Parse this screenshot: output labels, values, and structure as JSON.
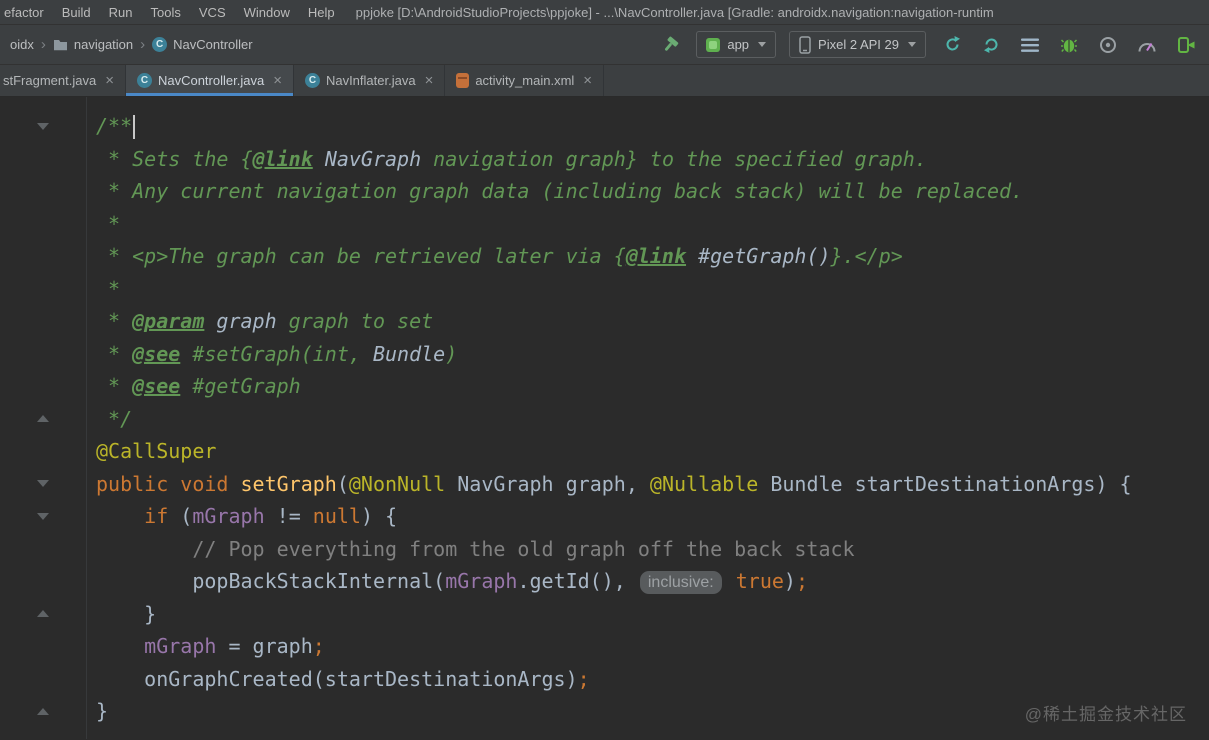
{
  "menu": {
    "items": [
      "efactor",
      "Build",
      "Run",
      "Tools",
      "VCS",
      "Window",
      "Help"
    ],
    "title": "ppjoke [D:\\AndroidStudioProjects\\ppjoke] - ...\\NavController.java [Gradle: androidx.navigation:navigation-runtim"
  },
  "breadcrumb": {
    "items": [
      {
        "label": "oidx",
        "icon": "none"
      },
      {
        "label": "navigation",
        "icon": "folder"
      },
      {
        "label": "NavController",
        "icon": "class"
      }
    ]
  },
  "toolbar": {
    "run_config": "app",
    "device": "Pixel 2 API 29",
    "icon_names": [
      "build-hammer-icon",
      "sync-icon",
      "apply-changes-icon",
      "logcat-list-icon",
      "debug-bug-icon",
      "coverage-icon",
      "profiler-icon",
      "attach-debugger-icon"
    ]
  },
  "tabs": [
    {
      "label": "stFragment.java",
      "icon": "none",
      "selected": false
    },
    {
      "label": "NavController.java",
      "icon": "class",
      "selected": true
    },
    {
      "label": "NavInflater.java",
      "icon": "class",
      "selected": false
    },
    {
      "label": "activity_main.xml",
      "icon": "xml",
      "selected": false
    }
  ],
  "editor": {
    "lines": [
      {
        "fold": "down",
        "tokens": [
          {
            "t": "/**",
            "c": "doc",
            "caret": true
          }
        ]
      },
      {
        "fold": "",
        "tokens": [
          {
            "t": " * Sets the {",
            "c": "doc"
          },
          {
            "t": "@link",
            "c": "docTag"
          },
          {
            "t": " ",
            "c": "doc"
          },
          {
            "t": "NavGraph",
            "c": "docVal"
          },
          {
            "t": " navigation graph} to the specified graph.",
            "c": "doc"
          }
        ]
      },
      {
        "fold": "",
        "tokens": [
          {
            "t": " * Any current navigation graph data (including back stack) will be replaced.",
            "c": "doc"
          }
        ]
      },
      {
        "fold": "",
        "tokens": [
          {
            "t": " *",
            "c": "doc"
          }
        ]
      },
      {
        "fold": "",
        "tokens": [
          {
            "t": " * <p>The graph can be retrieved later via {",
            "c": "doc"
          },
          {
            "t": "@link",
            "c": "docTag"
          },
          {
            "t": " ",
            "c": "doc"
          },
          {
            "t": "#getGraph()",
            "c": "docVal"
          },
          {
            "t": "}.</p>",
            "c": "doc"
          }
        ]
      },
      {
        "fold": "",
        "tokens": [
          {
            "t": " *",
            "c": "doc"
          }
        ]
      },
      {
        "fold": "",
        "tokens": [
          {
            "t": " * ",
            "c": "doc"
          },
          {
            "t": "@param",
            "c": "docTag"
          },
          {
            "t": " ",
            "c": "doc"
          },
          {
            "t": "graph",
            "c": "docVal"
          },
          {
            "t": " graph to set",
            "c": "doc"
          }
        ]
      },
      {
        "fold": "",
        "tokens": [
          {
            "t": " * ",
            "c": "doc"
          },
          {
            "t": "@see",
            "c": "docTag"
          },
          {
            "t": " #setGraph(int, ",
            "c": "doc"
          },
          {
            "t": "Bundle",
            "c": "docVal"
          },
          {
            "t": ")",
            "c": "doc"
          }
        ]
      },
      {
        "fold": "",
        "tokens": [
          {
            "t": " * ",
            "c": "doc"
          },
          {
            "t": "@see",
            "c": "docTag"
          },
          {
            "t": " #getGraph",
            "c": "doc"
          }
        ]
      },
      {
        "fold": "up",
        "tokens": [
          {
            "t": " */",
            "c": "doc"
          }
        ]
      },
      {
        "fold": "",
        "tokens": [
          {
            "t": "@CallSuper",
            "c": "ann"
          }
        ]
      },
      {
        "fold": "down",
        "tokens": [
          {
            "t": "public",
            "c": "kw"
          },
          {
            "t": " ",
            "c": "txt"
          },
          {
            "t": "void",
            "c": "kw"
          },
          {
            "t": " ",
            "c": "txt"
          },
          {
            "t": "setGraph",
            "c": "method"
          },
          {
            "t": "(",
            "c": "txt"
          },
          {
            "t": "@NonNull",
            "c": "ann"
          },
          {
            "t": " NavGraph graph, ",
            "c": "txt"
          },
          {
            "t": "@Nullable",
            "c": "ann"
          },
          {
            "t": " Bundle startDestinationArgs) {",
            "c": "txt"
          }
        ]
      },
      {
        "fold": "down",
        "tokens": [
          {
            "t": "    ",
            "c": "txt"
          },
          {
            "t": "if",
            "c": "kw"
          },
          {
            "t": " (",
            "c": "txt"
          },
          {
            "t": "mGraph",
            "c": "field"
          },
          {
            "t": " != ",
            "c": "txt"
          },
          {
            "t": "null",
            "c": "kw"
          },
          {
            "t": ") {",
            "c": "txt"
          }
        ]
      },
      {
        "fold": "",
        "tokens": [
          {
            "t": "        ",
            "c": "txt"
          },
          {
            "t": "// Pop everything from the old graph off the back stack",
            "c": "cmt"
          }
        ]
      },
      {
        "fold": "",
        "tokens": [
          {
            "t": "        popBackStackInternal(",
            "c": "txt"
          },
          {
            "t": "mGraph",
            "c": "field"
          },
          {
            "t": ".getId(), ",
            "c": "txt"
          },
          {
            "t": "inclusive:",
            "c": "hint"
          },
          {
            "t": " ",
            "c": "txt"
          },
          {
            "t": "true",
            "c": "kw"
          },
          {
            "t": ")",
            "c": "txt"
          },
          {
            "t": ";",
            "c": "semi"
          }
        ]
      },
      {
        "fold": "up",
        "tokens": [
          {
            "t": "    }",
            "c": "txt"
          }
        ]
      },
      {
        "fold": "",
        "tokens": [
          {
            "t": "    ",
            "c": "txt"
          },
          {
            "t": "mGraph",
            "c": "field"
          },
          {
            "t": " = graph",
            "c": "txt"
          },
          {
            "t": ";",
            "c": "semi"
          }
        ]
      },
      {
        "fold": "",
        "tokens": [
          {
            "t": "    onGraphCreated(startDestinationArgs)",
            "c": "txt"
          },
          {
            "t": ";",
            "c": "semi"
          }
        ]
      },
      {
        "fold": "up",
        "tokens": [
          {
            "t": "}",
            "c": "txt"
          }
        ]
      }
    ]
  },
  "watermark": "@稀土掘金技术社区"
}
